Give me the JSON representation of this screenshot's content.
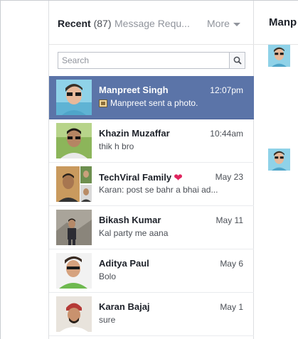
{
  "tabs": {
    "recent_label": "Recent",
    "recent_count": "(87)",
    "requests_label": "Message Requ...",
    "more_label": "More"
  },
  "search": {
    "placeholder": "Search"
  },
  "conversations": [
    {
      "name": "Manpreet Singh",
      "time": "12:07pm",
      "snippet": "Manpreet sent a photo.",
      "active": true,
      "snippet_icon": "photo-icon"
    },
    {
      "name": "Khazin Muzaffar",
      "time": "10:44am",
      "snippet": "thik h bro"
    },
    {
      "name": "TechViral Family",
      "time": "May 23",
      "snippet": "Karan: post se bahr a bhai ad...",
      "badge_icon": "heart-icon",
      "badge_color": "#e0245e"
    },
    {
      "name": "Bikash Kumar",
      "time": "May 11",
      "snippet": "Kal party me aana"
    },
    {
      "name": "Aditya Paul",
      "time": "May 6",
      "snippet": "Bolo"
    },
    {
      "name": "Karan Bajaj",
      "time": "May 1",
      "snippet": "sure"
    }
  ],
  "chat_header": {
    "name": "Manp"
  },
  "colors": {
    "active_row": "#5b74a8",
    "heart": "#e0245e"
  }
}
